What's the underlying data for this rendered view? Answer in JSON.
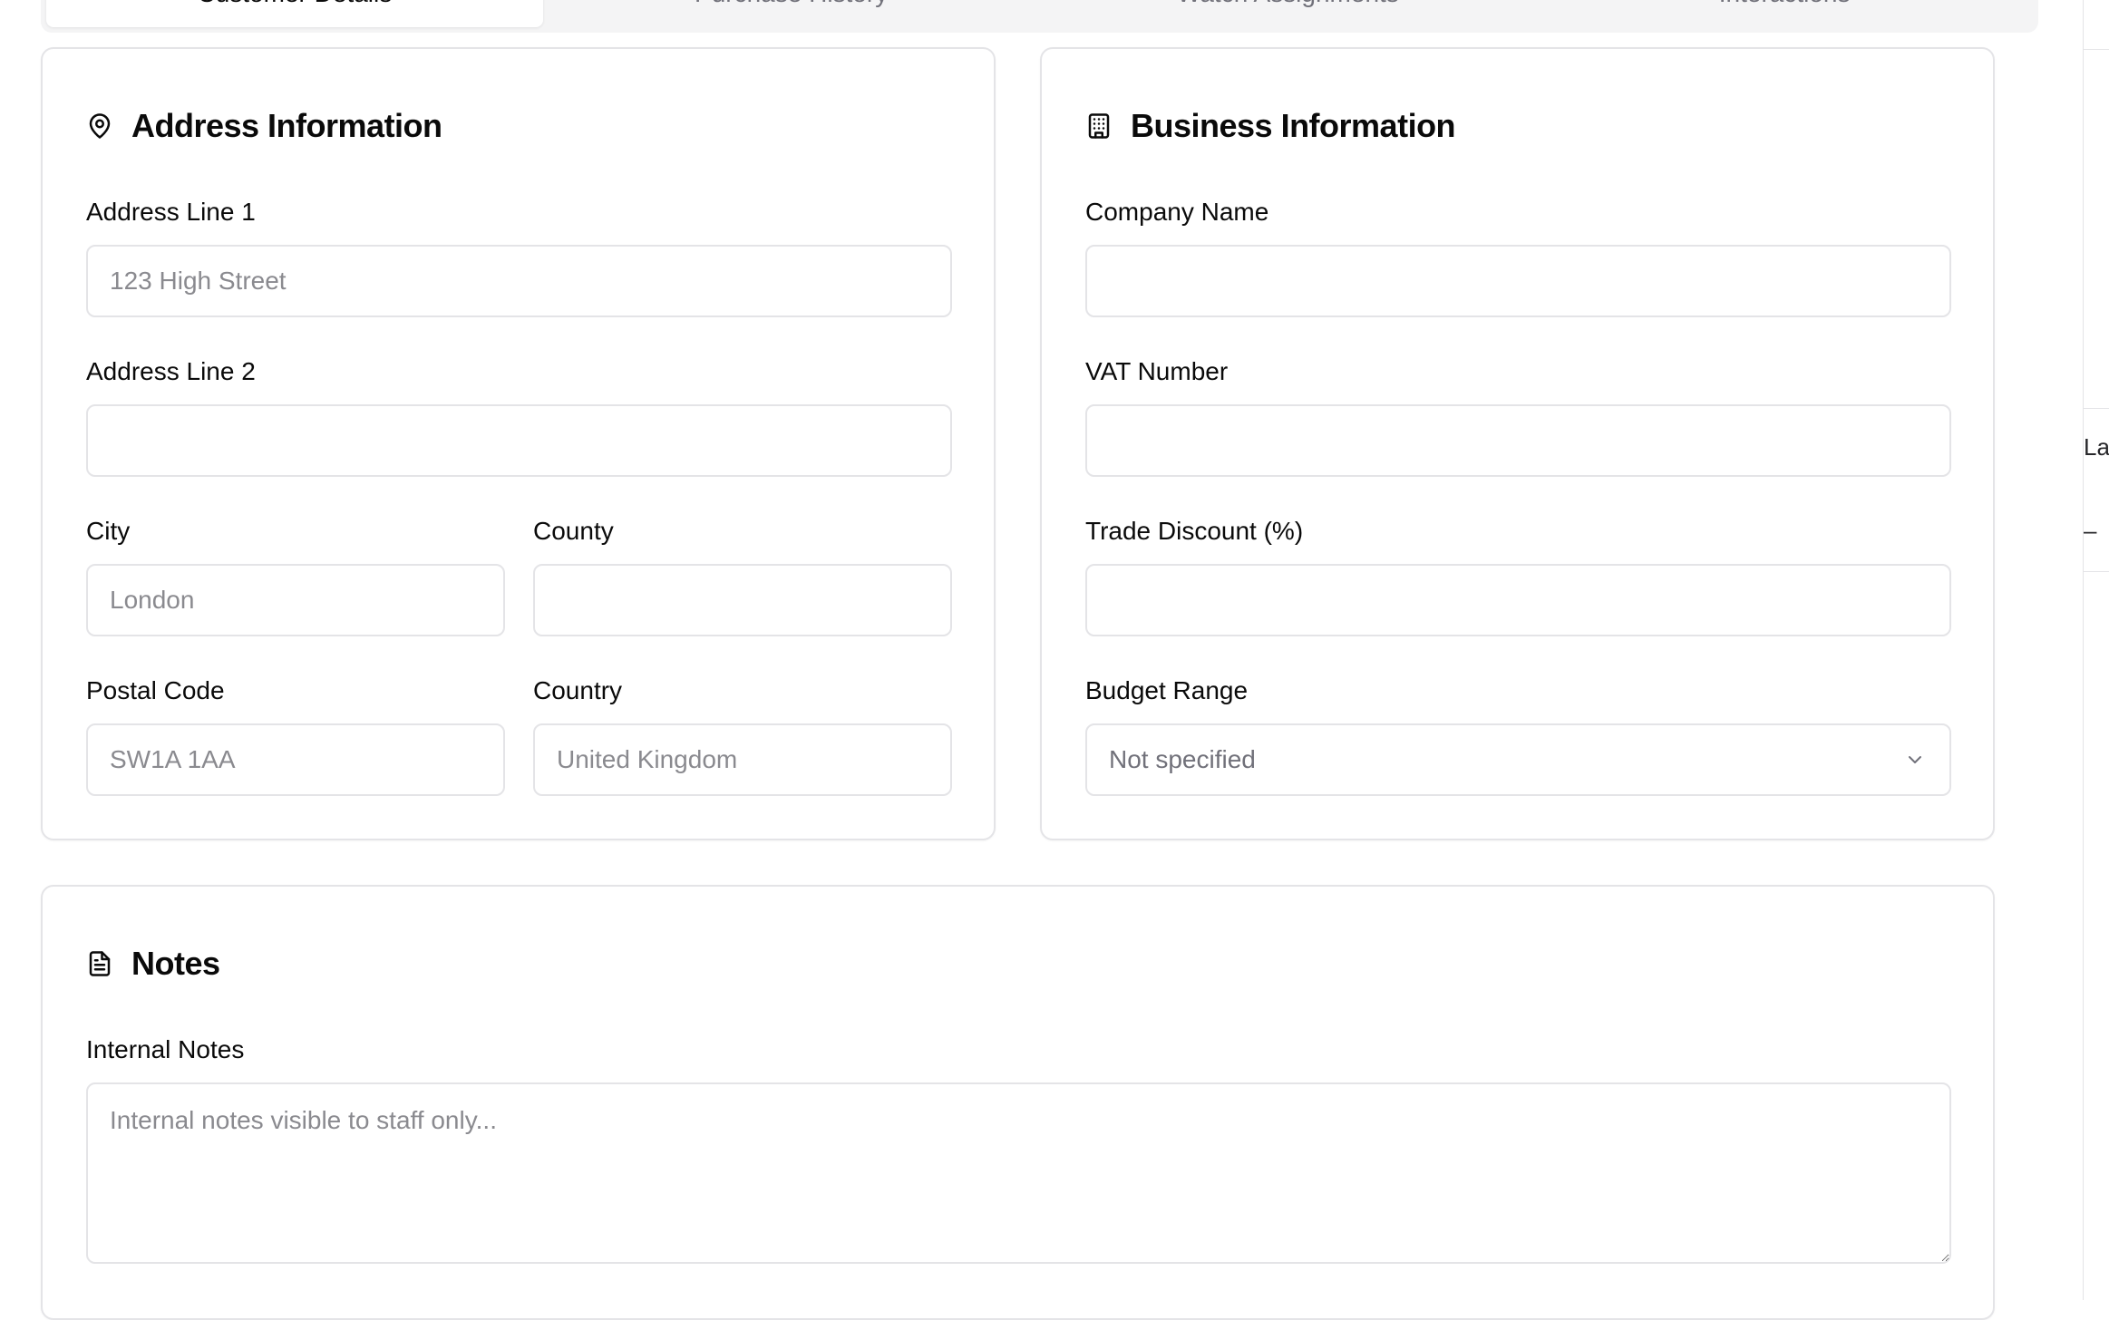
{
  "tabs": [
    {
      "label": "Customer Details",
      "active": true
    },
    {
      "label": "Purchase History",
      "active": false
    },
    {
      "label": "Watch Assignments",
      "active": false
    },
    {
      "label": "Interactions",
      "active": false
    }
  ],
  "right_panel": {
    "fragment_1": "La",
    "fragment_2": "–"
  },
  "address": {
    "title": "Address Information",
    "icon": "map-pin-icon",
    "line1": {
      "label": "Address Line 1",
      "value": "",
      "placeholder": "123 High Street"
    },
    "line2": {
      "label": "Address Line 2",
      "value": "",
      "placeholder": ""
    },
    "city": {
      "label": "City",
      "value": "",
      "placeholder": "London"
    },
    "county": {
      "label": "County",
      "value": "",
      "placeholder": ""
    },
    "postal_code": {
      "label": "Postal Code",
      "value": "",
      "placeholder": "SW1A 1AA"
    },
    "country": {
      "label": "Country",
      "value": "",
      "placeholder": "United Kingdom"
    }
  },
  "business": {
    "title": "Business Information",
    "icon": "building-icon",
    "company_name": {
      "label": "Company Name",
      "value": "",
      "placeholder": ""
    },
    "vat_number": {
      "label": "VAT Number",
      "value": "",
      "placeholder": ""
    },
    "trade_discount": {
      "label": "Trade Discount (%)",
      "value": "",
      "placeholder": ""
    },
    "budget_range": {
      "label": "Budget Range",
      "selected": "Not specified"
    }
  },
  "notes": {
    "title": "Notes",
    "icon": "file-text-icon",
    "internal": {
      "label": "Internal Notes",
      "value": "",
      "placeholder": "Internal notes visible to staff only..."
    }
  }
}
